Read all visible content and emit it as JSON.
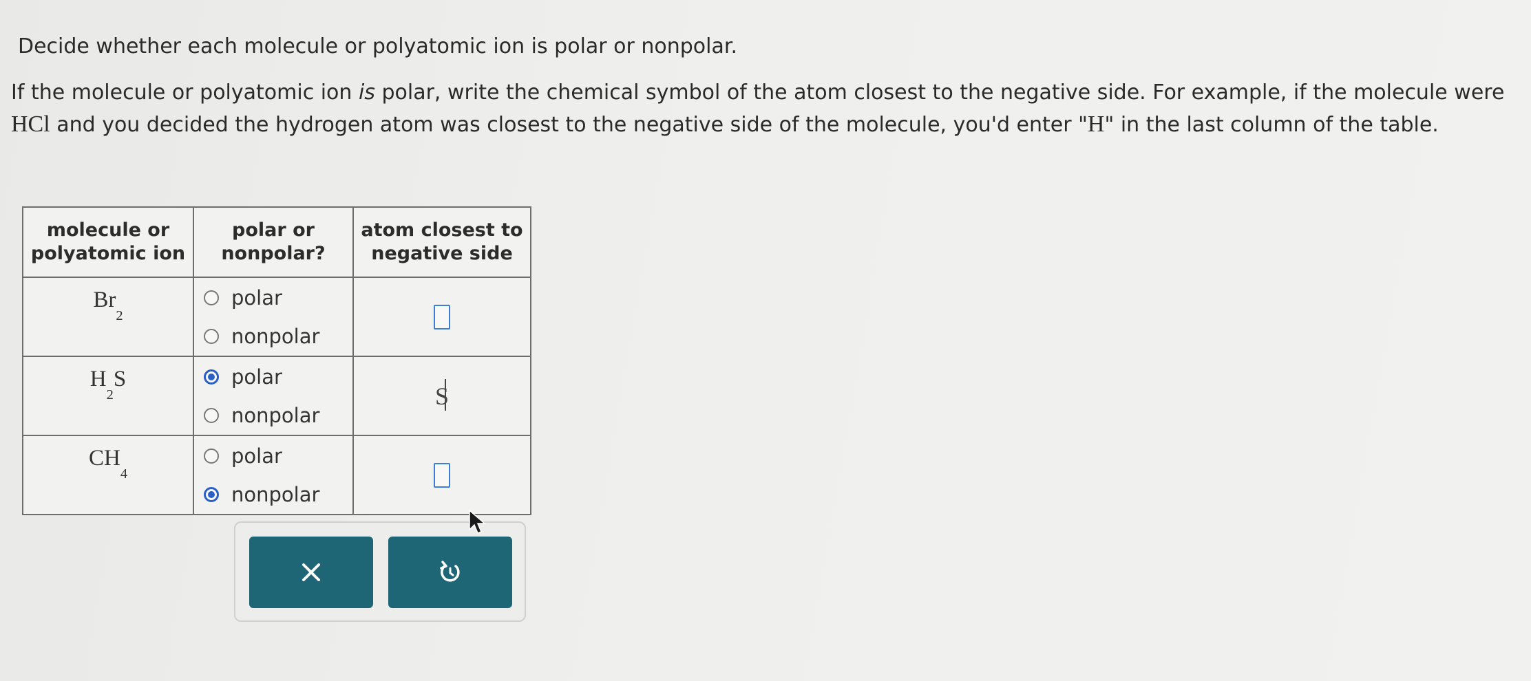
{
  "instructions": {
    "line1": "Decide whether each molecule or polyatomic ion is polar or nonpolar.",
    "p2_a": "If the molecule or polyatomic ion ",
    "p2_is": "is",
    "p2_b": " polar, write the chemical symbol of the atom closest to the negative side. For example, if the molecule were ",
    "p2_example": "HCl",
    "p2_c": " and you decided the hydrogen atom was closest to the negative side of the molecule, you'd enter \"",
    "p2_h": "H",
    "p2_d": "\" in the last column of the table."
  },
  "table": {
    "headers": {
      "col1_line1": "molecule or",
      "col1_line2": "polyatomic ion",
      "col2_line1": "polar or",
      "col2_line2": "nonpolar?",
      "col3_line1": "atom closest to",
      "col3_line2": "negative side"
    },
    "rows": [
      {
        "formula_main": "Br",
        "formula_sub": "2",
        "formula_tail": "",
        "option_polar": "polar",
        "option_nonpolar": "nonpolar",
        "selected": "none",
        "answer": ""
      },
      {
        "formula_main": "H",
        "formula_sub": "2",
        "formula_tail": "S",
        "option_polar": "polar",
        "option_nonpolar": "nonpolar",
        "selected": "polar",
        "answer": "S"
      },
      {
        "formula_main": "CH",
        "formula_sub": "4",
        "formula_tail": "",
        "option_polar": "polar",
        "option_nonpolar": "nonpolar",
        "selected": "nonpolar",
        "answer": ""
      }
    ]
  },
  "buttons": {
    "clear_icon": "x-icon",
    "undo_icon": "undo-icon"
  },
  "colors": {
    "button": "#1e6676",
    "radio_selected": "#2b5fc6",
    "input_border": "#3d7fd6"
  }
}
